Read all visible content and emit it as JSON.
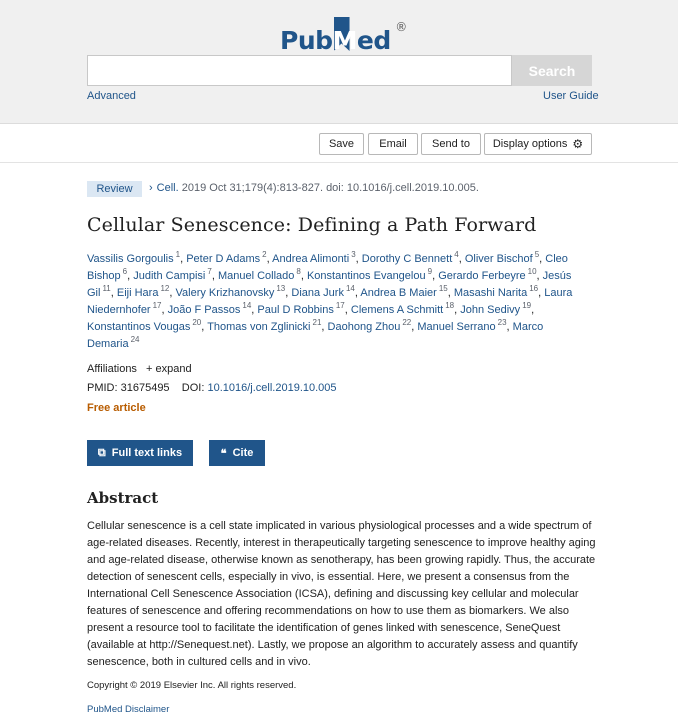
{
  "header": {
    "logo_pub": "Pub",
    "logo_med": "Med",
    "logo_reg": "®",
    "search_placeholder": "",
    "search_button": "Search",
    "advanced_link": "Advanced",
    "user_guide_link": "User Guide"
  },
  "toolbar": {
    "save": "Save",
    "email": "Email",
    "send_to": "Send to",
    "display_options": "Display options",
    "gear_icon": "⚙"
  },
  "article": {
    "type_badge": "Review",
    "journal": "Cell.",
    "citation_rest": " 2019 Oct 31;179(4):813-827. doi: 10.1016/j.cell.2019.10.005.",
    "title": "Cellular Senescence: Defining a Path Forward",
    "authors": [
      {
        "name": "Vassilis Gorgoulis",
        "sup": "1",
        "sep": ", "
      },
      {
        "name": "Peter D Adams",
        "sup": "2",
        "sep": ", "
      },
      {
        "name": "Andrea Alimonti",
        "sup": "3",
        "sep": ", "
      },
      {
        "name": "Dorothy C Bennett",
        "sup": "4",
        "sep": ", "
      },
      {
        "name": "Oliver Bischof",
        "sup": "5",
        "sep": ", "
      },
      {
        "name": "Cleo Bishop",
        "sup": "6",
        "sep": ", "
      },
      {
        "name": "Judith Campisi",
        "sup": "7",
        "sep": ", "
      },
      {
        "name": "Manuel Collado",
        "sup": "8",
        "sep": ", "
      },
      {
        "name": "Konstantinos Evangelou",
        "sup": "9",
        "sep": ", "
      },
      {
        "name": "Gerardo Ferbeyre",
        "sup": "10",
        "sep": ", "
      },
      {
        "name": "Jesús Gil",
        "sup": "11",
        "sep": ", "
      },
      {
        "name": "Eiji Hara",
        "sup": "12",
        "sep": ", "
      },
      {
        "name": "Valery Krizhanovsky",
        "sup": "13",
        "sep": ", "
      },
      {
        "name": "Diana Jurk",
        "sup": "14",
        "sep": ", "
      },
      {
        "name": "Andrea B Maier",
        "sup": "15",
        "sep": ", "
      },
      {
        "name": "Masashi Narita",
        "sup": "16",
        "sep": ", "
      },
      {
        "name": "Laura Niedernhofer",
        "sup": "17",
        "sep": ", "
      },
      {
        "name": "João F Passos",
        "sup": "14",
        "sep": ", "
      },
      {
        "name": "Paul D Robbins",
        "sup": "17",
        "sep": ", "
      },
      {
        "name": "Clemens A Schmitt",
        "sup": "18",
        "sep": ", "
      },
      {
        "name": "John Sedivy",
        "sup": "19",
        "sep": ", "
      },
      {
        "name": "Konstantinos Vougas",
        "sup": "20",
        "sep": ", "
      },
      {
        "name": "Thomas von Zglinicki",
        "sup": "21",
        "sep": ", "
      },
      {
        "name": "Daohong Zhou",
        "sup": "22",
        "sep": ", "
      },
      {
        "name": "Manuel Serrano",
        "sup": "23",
        "sep": ", "
      },
      {
        "name": "Marco Demaria",
        "sup": "24",
        "sep": ""
      }
    ],
    "affiliations_label": "Affiliations",
    "expand_label": "+ expand",
    "pmid_label": "PMID: 31675495",
    "doi_label": "DOI:",
    "doi_value": "10.1016/j.cell.2019.10.005",
    "free_article": "Free article"
  },
  "actions": {
    "full_text_links": "Full text links",
    "cite": "Cite",
    "full_text_icon": "⧉",
    "cite_icon": "❝"
  },
  "abstract": {
    "heading": "Abstract",
    "text": "Cellular senescence is a cell state implicated in various physiological processes and a wide spectrum of age-related diseases. Recently, interest in therapeutically targeting senescence to improve healthy aging and age-related disease, otherwise known as senotherapy, has been growing rapidly. Thus, the accurate detection of senescent cells, especially in vivo, is essential. Here, we present a consensus from the International Cell Senescence Association (ICSA), defining and discussing key cellular and molecular features of senescence and offering recommendations on how to use them as biomarkers. We also present a resource tool to facilitate the identification of genes linked with senescence, SeneQuest (available at http://Senequest.net). Lastly, we propose an algorithm to accurately assess and quantify senescence, both in cultured cells and in vivo.",
    "copyright": "Copyright © 2019 Elsevier Inc. All rights reserved.",
    "disclaimer": "PubMed Disclaimer"
  },
  "colors": {
    "brand_blue": "#20558a",
    "free_orange": "#b85c00",
    "header_bg": "#f0f0f0"
  }
}
